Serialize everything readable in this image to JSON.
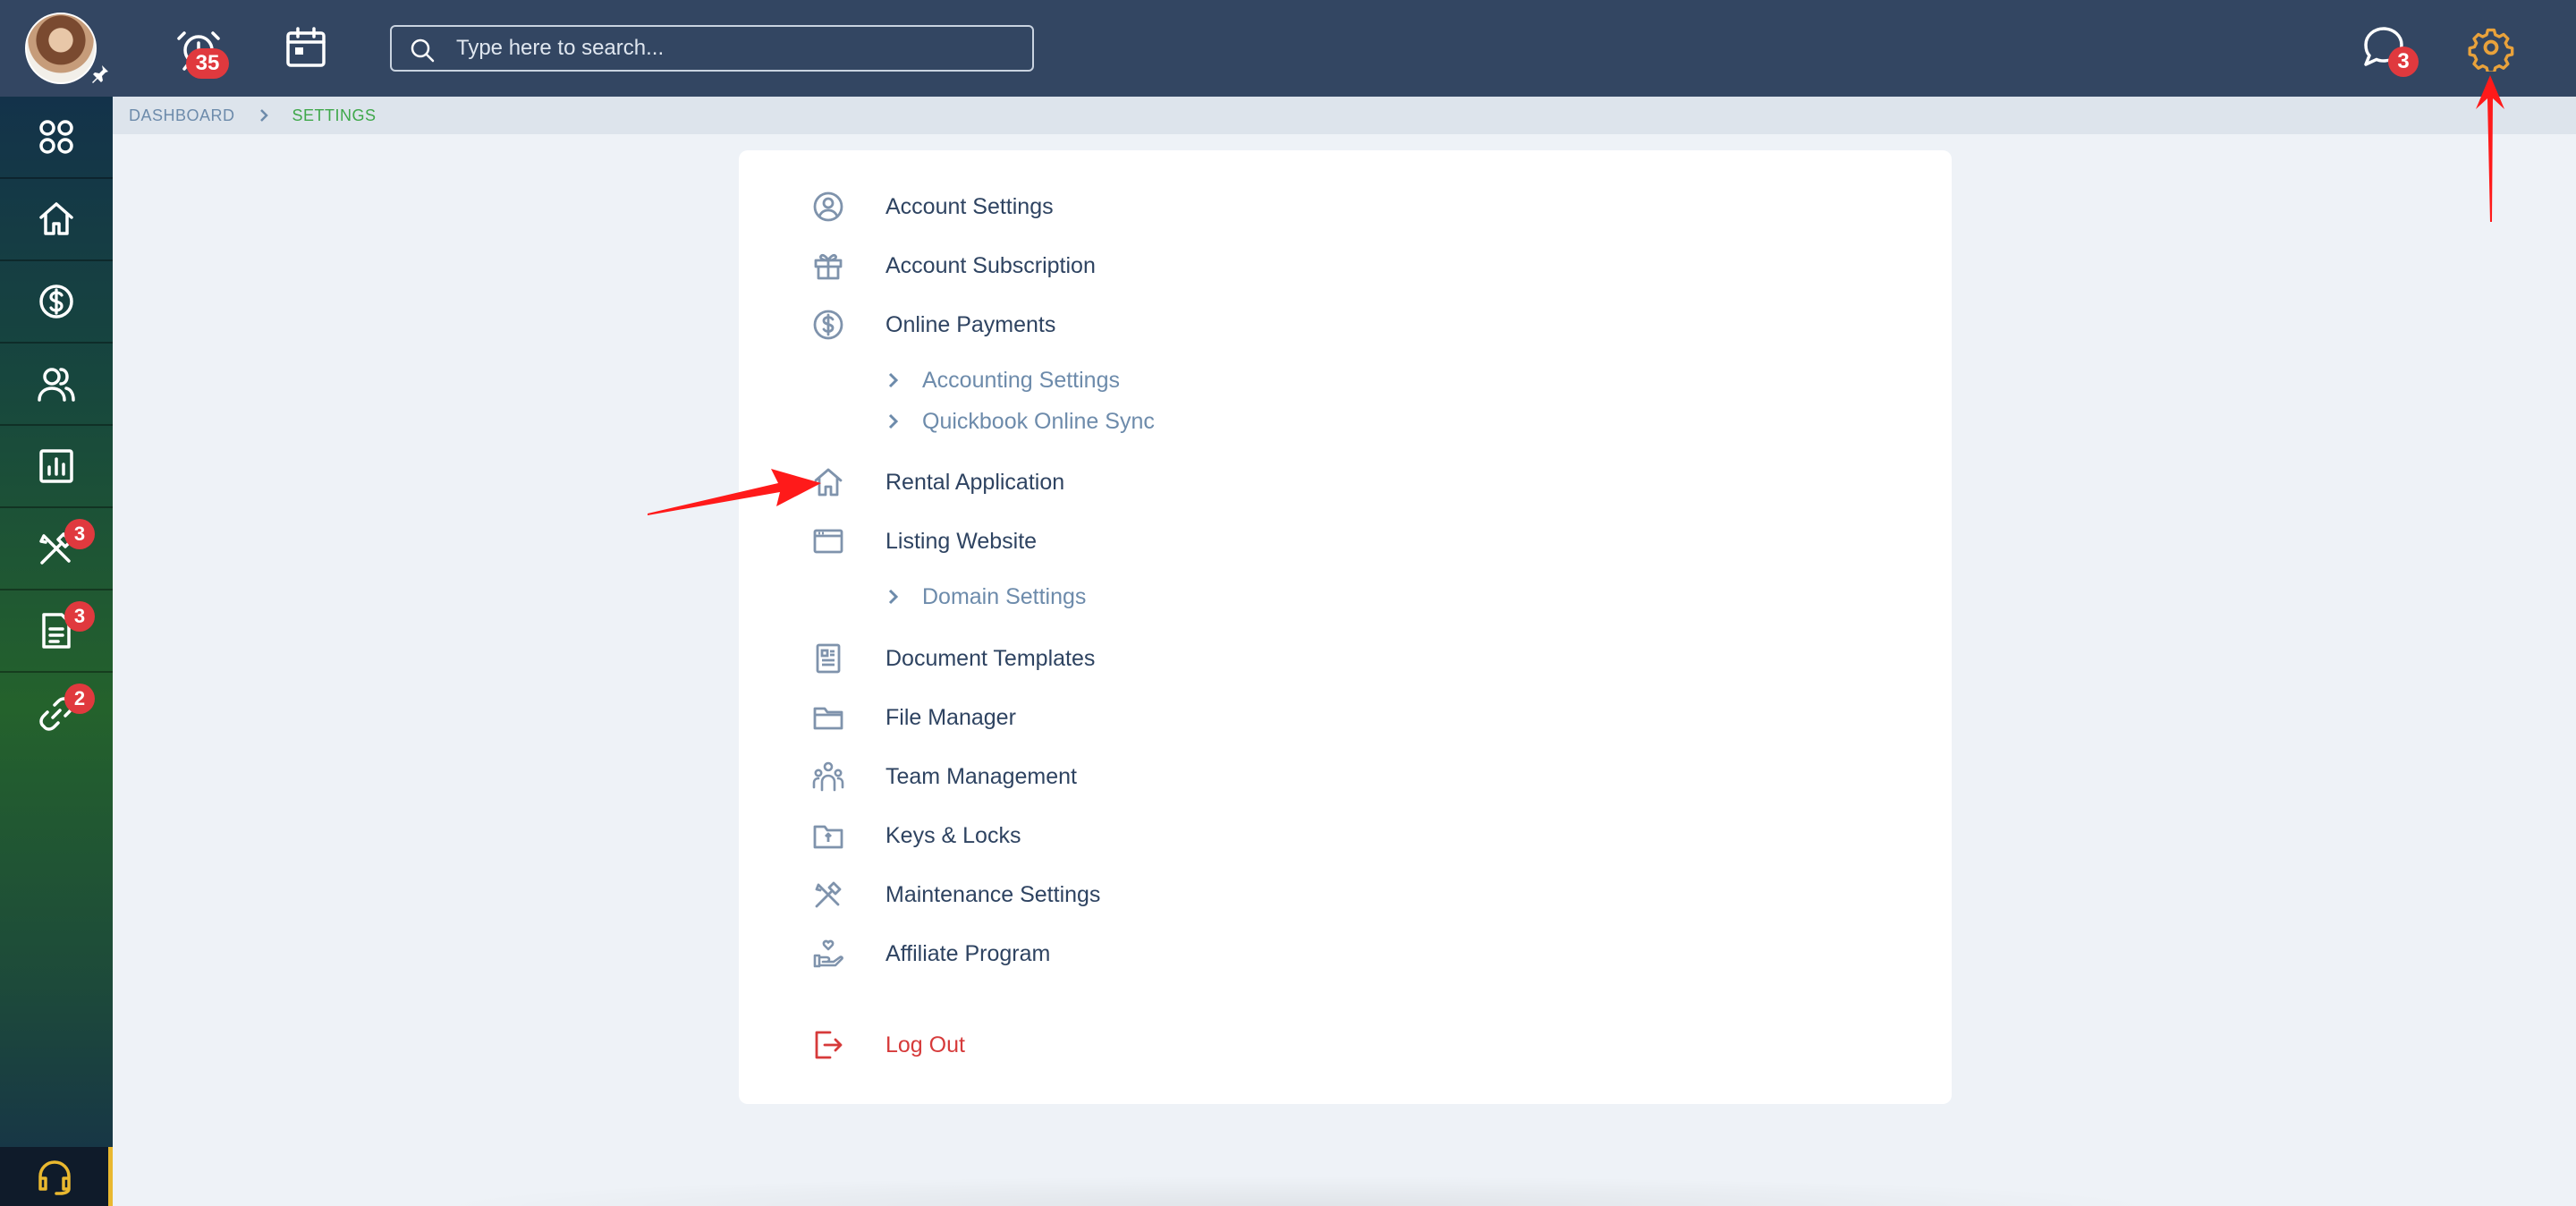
{
  "topbar": {
    "notifications_count": "35",
    "search_placeholder": "Type here to search...",
    "messages_count": "3",
    "colors": {
      "background": "#334662",
      "badge": "#e0393e",
      "settings_icon": "#e9a23b"
    }
  },
  "sidebar": {
    "items": [
      {
        "icon": "apps-grid-icon"
      },
      {
        "icon": "home-icon"
      },
      {
        "icon": "dollar-icon"
      },
      {
        "icon": "users-icon"
      },
      {
        "icon": "chart-icon"
      },
      {
        "icon": "tools-icon",
        "badge": "3"
      },
      {
        "icon": "document-icon",
        "badge": "3"
      },
      {
        "icon": "link-icon",
        "badge": "2"
      }
    ],
    "support_icon": "headset-icon",
    "colors": {
      "support_accent": "#e9b82f"
    }
  },
  "breadcrumb": {
    "dashboard": "DASHBOARD",
    "current": "SETTINGS"
  },
  "settings_menu": {
    "items": [
      {
        "label": "Account Settings",
        "icon": "user-circle-icon"
      },
      {
        "label": "Account Subscription",
        "icon": "gift-icon"
      },
      {
        "label": "Online Payments",
        "icon": "dollar-circle-icon"
      },
      {
        "label": "Accounting Settings",
        "sub": true
      },
      {
        "label": "Quickbook Online Sync",
        "sub": true
      },
      {
        "label": "Rental Application",
        "icon": "home-icon"
      },
      {
        "label": "Listing Website",
        "icon": "browser-icon"
      },
      {
        "label": "Domain Settings",
        "sub": true
      },
      {
        "label": "Document Templates",
        "icon": "document-template-icon"
      },
      {
        "label": "File Manager",
        "icon": "folder-icon"
      },
      {
        "label": "Team Management",
        "icon": "team-icon"
      },
      {
        "label": "Keys & Locks",
        "icon": "key-folder-icon"
      },
      {
        "label": "Maintenance Settings",
        "icon": "tools-icon"
      },
      {
        "label": "Affiliate Program",
        "icon": "hand-heart-icon"
      },
      {
        "label": "Log Out",
        "icon": "logout-icon"
      }
    ],
    "colors": {
      "label": "#2e4361",
      "sublabel": "#6d8bab",
      "icon": "#7f93ac",
      "logout": "#d63a3a"
    }
  }
}
